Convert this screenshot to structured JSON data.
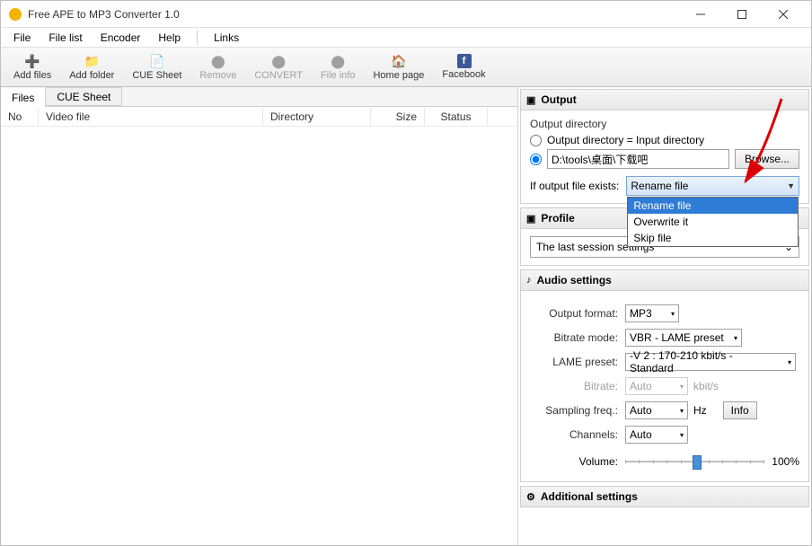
{
  "window": {
    "title": "Free APE to MP3 Converter 1.0"
  },
  "menu": {
    "file": "File",
    "filelist": "File list",
    "encoder": "Encoder",
    "help": "Help",
    "links": "Links"
  },
  "toolbar": {
    "add_files": "Add files",
    "add_folder": "Add folder",
    "cue_sheet": "CUE Sheet",
    "remove": "Remove",
    "convert": "CONVERT",
    "file_info": "File info",
    "home_page": "Home page",
    "facebook": "Facebook"
  },
  "tabs": {
    "files": "Files",
    "cue": "CUE Sheet"
  },
  "columns": {
    "no": "No",
    "video": "Video file",
    "directory": "Directory",
    "size": "Size",
    "status": "Status"
  },
  "output": {
    "header": "Output",
    "dir_label": "Output directory",
    "same_as_input": "Output directory = Input directory",
    "path": "D:\\tools\\桌面\\下载吧",
    "browse": "Browse...",
    "exists_label": "If output file exists:",
    "exists_value": "Rename file",
    "exists_options": [
      "Rename file",
      "Overwrite it",
      "Skip file"
    ]
  },
  "profile": {
    "header": "Profile",
    "value": "The last session settings"
  },
  "audio": {
    "header": "Audio settings",
    "format_label": "Output format:",
    "format_value": "MP3",
    "bitrate_mode_label": "Bitrate mode:",
    "bitrate_mode_value": "VBR - LAME preset",
    "lame_label": "LAME preset:",
    "lame_value": "-V 2 : 170-210 kbit/s - Standard",
    "bitrate_label": "Bitrate:",
    "bitrate_value": "Auto",
    "bitrate_unit": "kbit/s",
    "sampling_label": "Sampling freq.:",
    "sampling_value": "Auto",
    "sampling_unit": "Hz",
    "channels_label": "Channels:",
    "channels_value": "Auto",
    "info": "Info",
    "volume_label": "Volume:",
    "volume_value": "100%"
  },
  "additional": {
    "header": "Additional settings"
  }
}
